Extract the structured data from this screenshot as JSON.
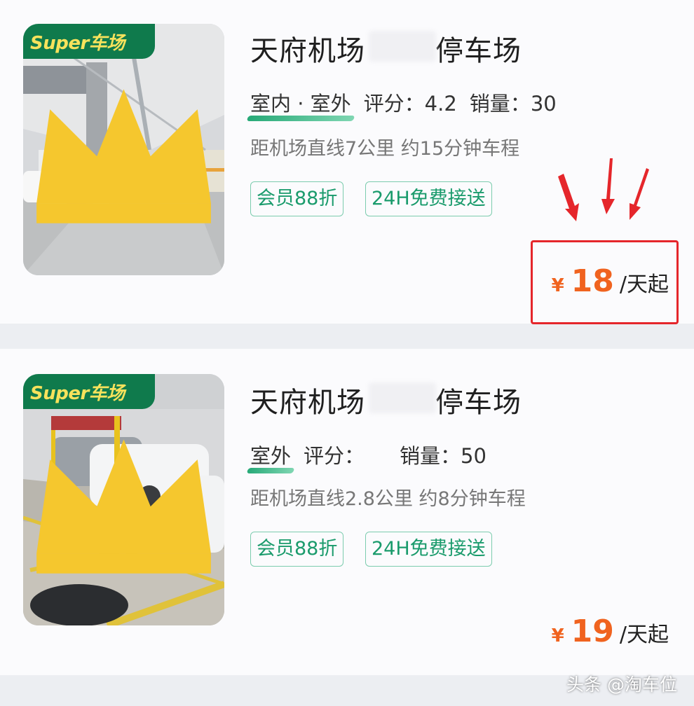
{
  "listings": [
    {
      "badge": "Super车场",
      "title": "天府机场",
      "title_tail": "停车场",
      "environment": "室内 · 室外",
      "rating_label": "评分：",
      "rating": "4.2",
      "sales_label": "销量：",
      "sales": "30",
      "distance": "距机场直线7公里 约15分钟车程",
      "tags": [
        "会员88折",
        "24H免费接送"
      ],
      "price": {
        "currency": "¥",
        "amount": "18",
        "unit": "/天起"
      }
    },
    {
      "badge": "Super车场",
      "title": "天府机场",
      "title_tail": "停车场",
      "environment": "室外",
      "rating_label": "评分：",
      "rating": "",
      "sales_label": "销量：",
      "sales": "50",
      "distance": "距机场直线2.8公里 约8分钟车程",
      "tags": [
        "会员88折",
        "24H免费接送"
      ],
      "price": {
        "currency": "¥",
        "amount": "19",
        "unit": "/天起"
      }
    }
  ],
  "annotation": {
    "box_color": "#e5262b",
    "arrow_count": 3
  },
  "watermark": "头条 @淘车位",
  "colors": {
    "brand_green": "#0f7a4c",
    "badge_text": "#f7e25c",
    "price": "#f0631f",
    "tag": "#1a9b6c"
  }
}
